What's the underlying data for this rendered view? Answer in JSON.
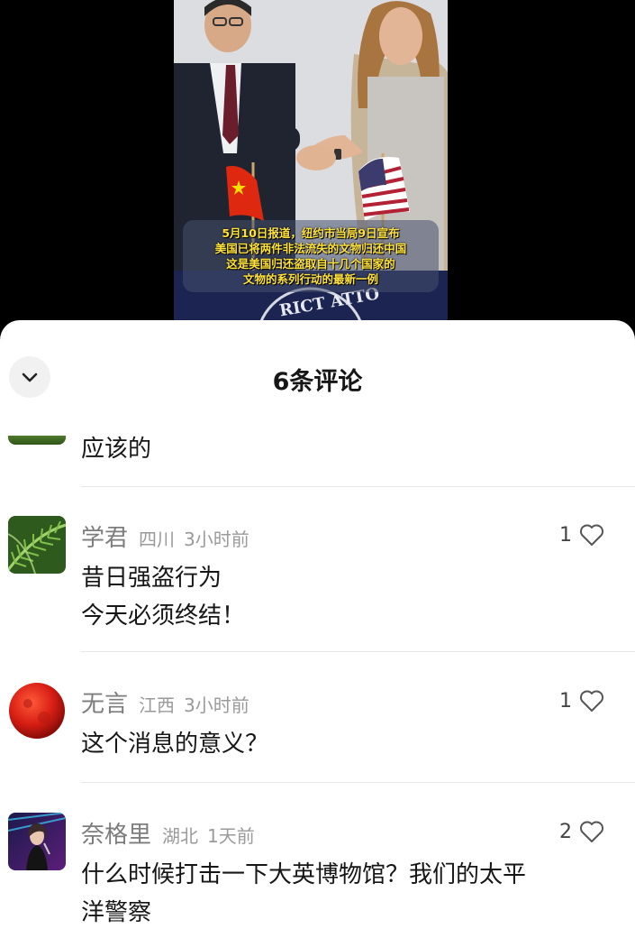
{
  "video": {
    "caption_lines": [
      "5月10日报道，纽约市当局9日宣布",
      "美国已将两件非法流失的文物归还中国",
      "这是美国归还盗取自十几个国家的",
      "文物的系列行动的最新一例"
    ],
    "seal_text": "RICT ATTO"
  },
  "sheet": {
    "title": "6条评论",
    "collapse_icon": "chevron-down-icon"
  },
  "partial_comment": {
    "text": "应该的"
  },
  "comments": [
    {
      "username": "学君",
      "location": "四川",
      "time": "3小时前",
      "likes": "1",
      "lines": [
        "昔日强盗行为",
        "今天必须终结！"
      ],
      "avatar": "fern-avatar"
    },
    {
      "username": "无言",
      "location": "江西",
      "time": "3小时前",
      "likes": "1",
      "lines": [
        "这个消息的意义？"
      ],
      "avatar": "red-moon-avatar"
    },
    {
      "username": "奈格里",
      "location": "湖北",
      "time": "1天前",
      "likes": "2",
      "lines": [
        "什么时候打击一下大英博物馆？我们的太平",
        "洋警察"
      ],
      "avatar": "singer-avatar"
    }
  ],
  "colors": {
    "caption_text": "#ffe23a",
    "sheet_bg": "#ffffff",
    "meta_text": "#9a9a9a"
  }
}
